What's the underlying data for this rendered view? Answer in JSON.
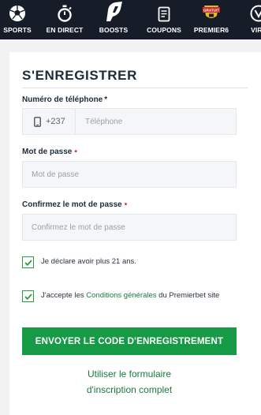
{
  "nav": {
    "items": [
      {
        "label": "SPORTS",
        "icon": "soccer-ball-icon"
      },
      {
        "label": "EN DIRECT",
        "icon": "stopwatch-icon"
      },
      {
        "label": "BOOSTS",
        "icon": "boost-arrow-icon"
      },
      {
        "label": "COUPONS",
        "icon": "coupon-icon"
      },
      {
        "label": "PREMIER6",
        "icon": "premier6-badge-icon",
        "badge": "GRATUIT"
      },
      {
        "label": "VIRT",
        "icon": "virtual-icon"
      }
    ]
  },
  "form": {
    "title": "S'ENREGISTRER",
    "phone": {
      "label": "Numéro de téléphone",
      "required_mark": "*",
      "prefix": "+237",
      "placeholder": "Téléphone"
    },
    "password": {
      "label": "Mot de passe",
      "required_mark": "•",
      "placeholder": "Mot de passe"
    },
    "confirm": {
      "label": "Confirmez le mot de passe",
      "required_mark": "•",
      "placeholder": "Confirmez le mot de passe"
    },
    "check_age": {
      "text": "Je déclare avoir plus 21 ans.",
      "checked": true
    },
    "check_terms": {
      "text_before": "J'accepte les ",
      "link": "Conditions générales",
      "text_after": " du Premierbet site",
      "checked": true
    },
    "submit_label": "ENVOYER LE CODE D'ENREGISTREMENT",
    "alt_link_line1": "Utiliser le formulaire",
    "alt_link_line2": "d'inscription complet"
  },
  "colors": {
    "nav_bg": "#161d28",
    "accent_green": "#179a45",
    "link_green": "#1a7a3e",
    "required_red": "#e03434"
  }
}
